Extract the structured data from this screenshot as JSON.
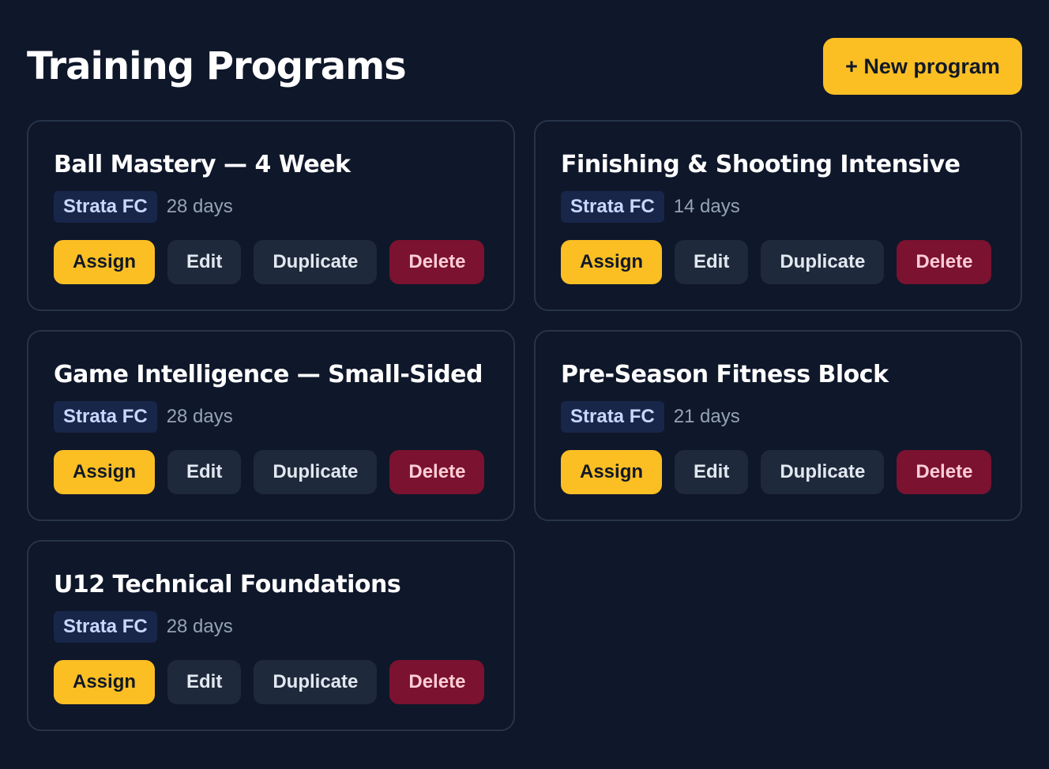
{
  "header": {
    "title": "Training Programs",
    "new_program_label": "+ New program"
  },
  "actions": {
    "assign": "Assign",
    "edit": "Edit",
    "duplicate": "Duplicate",
    "delete": "Delete"
  },
  "programs": [
    {
      "title": "Ball Mastery — 4 Week",
      "club": "Strata FC",
      "duration": "28 days"
    },
    {
      "title": "Finishing & Shooting Intensive",
      "club": "Strata FC",
      "duration": "14 days"
    },
    {
      "title": "Game Intelligence — Small-Sided",
      "club": "Strata FC",
      "duration": "28 days"
    },
    {
      "title": "Pre-Season Fitness Block",
      "club": "Strata FC",
      "duration": "21 days"
    },
    {
      "title": "U12 Technical Foundations",
      "club": "Strata FC",
      "duration": "28 days"
    }
  ],
  "colors": {
    "background": "#0f172a",
    "accent": "#fbbf24",
    "danger": "#7a1230",
    "card_border": "#263449"
  }
}
